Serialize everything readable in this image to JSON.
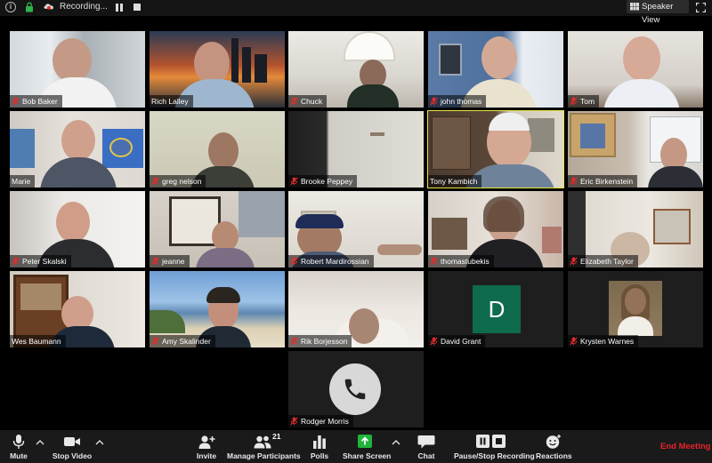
{
  "topbar": {
    "recording_label": "Recording...",
    "speaker_view_label": "Speaker View"
  },
  "participants": [
    {
      "name": "Bob Baker"
    },
    {
      "name": "Rich Lalley"
    },
    {
      "name": "Chuck"
    },
    {
      "name": "john thomas"
    },
    {
      "name": "Tom"
    },
    {
      "name": "Marie"
    },
    {
      "name": "greg nelson"
    },
    {
      "name": "Brooke Peppey"
    },
    {
      "name": "Tony Kambich"
    },
    {
      "name": "Eric Birkenstein"
    },
    {
      "name": "Peter Skalski"
    },
    {
      "name": "jeanne"
    },
    {
      "name": "Robert Mardirossian"
    },
    {
      "name": "thomastubekis"
    },
    {
      "name": "Elizabeth Taylor"
    },
    {
      "name": "Wes Baumann"
    },
    {
      "name": "Amy Skalinder"
    },
    {
      "name": "Rik Borjesson"
    },
    {
      "name": "David Grant",
      "avatar_letter": "D"
    },
    {
      "name": "Krysten Warnes"
    },
    {
      "name": "Rodger Morris"
    }
  ],
  "toolbar": {
    "mute": "Mute",
    "stop_video": "Stop Video",
    "invite": "Invite",
    "manage_participants": "Manage Participants",
    "participant_count": "21",
    "polls": "Polls",
    "share_screen": "Share Screen",
    "chat": "Chat",
    "pause_stop_recording": "Pause/Stop Recording",
    "reactions": "Reactions",
    "end_meeting": "End Meeting"
  },
  "colors": {
    "active_speaker_border": "#e6e63c",
    "end_meeting": "#e8232a",
    "share_screen_green": "#1fb53a",
    "avatar_green": "#0e6b4d",
    "mic_off_red": "#e02d2d"
  }
}
